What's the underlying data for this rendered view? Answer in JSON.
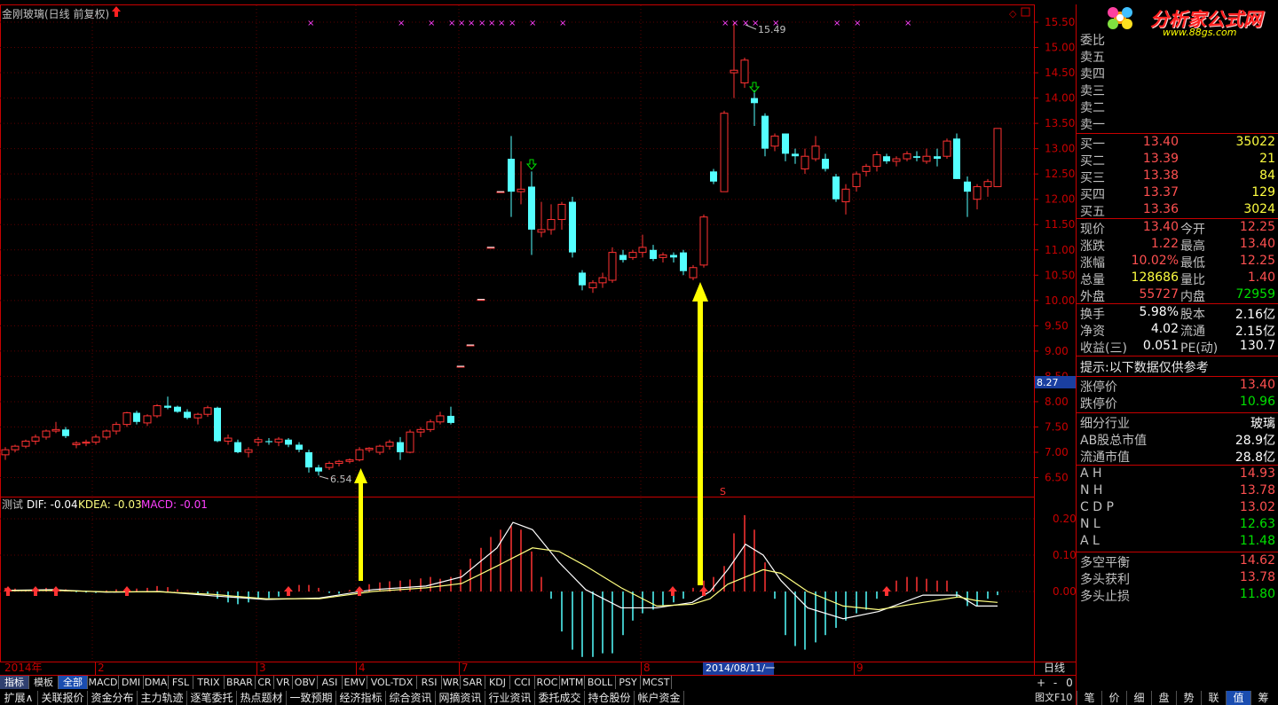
{
  "window": {
    "title": "金刚玻璃(日线 前复权)"
  },
  "logo": {
    "text": "分析家公式网",
    "url": "www.88gs.com"
  },
  "price_axis": {
    "labels": [
      "15.50",
      "15.00",
      "14.50",
      "14.00",
      "13.50",
      "13.00",
      "12.50",
      "12.00",
      "11.50",
      "11.00",
      "10.50",
      "10.00",
      "9.50",
      "9.00",
      "8.50",
      "8.00",
      "7.50",
      "7.00",
      "6.50"
    ],
    "current_marker": "8.27"
  },
  "indicator_axis": {
    "labels": [
      "0.20",
      "0.10",
      "0.00"
    ]
  },
  "annotations": {
    "high": "15.49",
    "low": "6.54",
    "s_marker": "S"
  },
  "indicator_header": {
    "name": "测试",
    "dif": "DIF: -0.04",
    "kdea": "KDEA: -0.03",
    "macd": "MACD: -0.01"
  },
  "time_axis": {
    "labels": [
      "2014年",
      "2",
      "3",
      "4",
      "7",
      "8",
      "9"
    ],
    "cursor_date": "2014/08/11/一",
    "period": "日线"
  },
  "order_book": {
    "header": "委比",
    "sells": [
      "卖五",
      "卖四",
      "卖三",
      "卖二",
      "卖一"
    ],
    "buys": [
      {
        "label": "买一",
        "price": "13.40",
        "vol": "35022"
      },
      {
        "label": "买二",
        "price": "13.39",
        "vol": "21"
      },
      {
        "label": "买三",
        "price": "13.38",
        "vol": "84"
      },
      {
        "label": "买四",
        "price": "13.37",
        "vol": "129"
      },
      {
        "label": "买五",
        "price": "13.36",
        "vol": "3024"
      }
    ]
  },
  "quote": [
    {
      "l1": "现价",
      "v1": "13.40",
      "c1": "red",
      "l2": "今开",
      "v2": "12.25",
      "c2": "red"
    },
    {
      "l1": "涨跌",
      "v1": "1.22",
      "c1": "red",
      "l2": "最高",
      "v2": "13.40",
      "c2": "red"
    },
    {
      "l1": "涨幅",
      "v1": "10.02%",
      "c1": "red",
      "l2": "最低",
      "v2": "12.25",
      "c2": "red"
    },
    {
      "l1": "总量",
      "v1": "128686",
      "c1": "yellow",
      "l2": "量比",
      "v2": "1.40",
      "c2": "red"
    },
    {
      "l1": "外盘",
      "v1": "55727",
      "c1": "red",
      "l2": "内盘",
      "v2": "72959",
      "c2": "green"
    }
  ],
  "finance": [
    {
      "l1": "换手",
      "v1": "5.98%",
      "l2": "股本",
      "v2": "2.16亿"
    },
    {
      "l1": "净资",
      "v1": "4.02",
      "l2": "流通",
      "v2": "2.15亿"
    },
    {
      "l1": "收益(三)",
      "v1": "0.051",
      "l2": "PE(动)",
      "v2": "130.7"
    }
  ],
  "hint": "提示:以下数据仅供参考",
  "limits": [
    {
      "label": "涨停价",
      "value": "13.40",
      "color": "red"
    },
    {
      "label": "跌停价",
      "value": "10.96",
      "color": "green"
    }
  ],
  "industry": [
    {
      "label": "细分行业",
      "value": "玻璃"
    },
    {
      "label": "AB股总市值",
      "value": "28.9亿"
    },
    {
      "label": "流通市值",
      "value": "28.8亿"
    }
  ],
  "levels1": [
    {
      "label": "A H",
      "value": "14.93"
    },
    {
      "label": "N H",
      "value": "13.78"
    },
    {
      "label": "C D P",
      "value": "13.02"
    },
    {
      "label": "N L",
      "value": "12.63"
    },
    {
      "label": "A L",
      "value": "11.48"
    }
  ],
  "levels2": [
    {
      "label": "多空平衡",
      "value": "14.62",
      "color": "red"
    },
    {
      "label": "多头获利",
      "value": "13.78",
      "color": "red"
    },
    {
      "label": "多头止损",
      "value": "11.80",
      "color": "green"
    }
  ],
  "indicator_tabs": [
    "指标",
    "模板",
    "全部",
    "MACD",
    "DMI",
    "DMA",
    "FSL",
    "TRIX",
    "BRAR",
    "CR",
    "VR",
    "OBV",
    "ASI",
    "EMV",
    "VOL-TDX",
    "RSI",
    "WR",
    "SAR",
    "KDJ",
    "CCI",
    "ROC",
    "MTM",
    "BOLL",
    "PSY",
    "MCST"
  ],
  "bottom_tabs": [
    "扩展∧",
    "关联报价",
    "资金分布",
    "主力轨迹",
    "逐笔委托",
    "热点题材",
    "一致预期",
    "经济指标",
    "综合资讯",
    "网摘资讯",
    "行业资讯",
    "委托成交",
    "持仓股份",
    "帐户资金"
  ],
  "right_controls": {
    "plus": "+",
    "minus": "-",
    "zero": "0",
    "f10": "图文F10"
  },
  "right_tabs": [
    "笔",
    "价",
    "细",
    "盘",
    "势",
    "联",
    "值",
    "筹"
  ],
  "colors": {
    "up": "#ff3232",
    "down": "#54ffff",
    "border": "#c80000",
    "arrow": "#ffff00"
  }
}
